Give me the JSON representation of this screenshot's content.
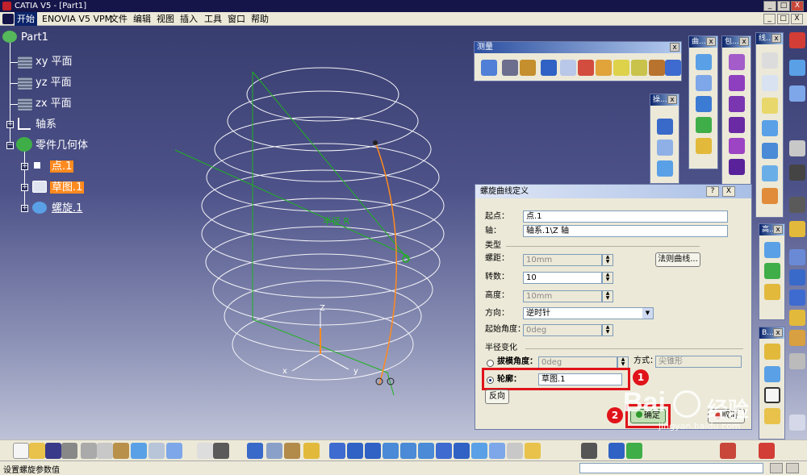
{
  "window": {
    "title": "CATIA V5 - [Part1]",
    "min": "_",
    "max": "□",
    "close": "X"
  },
  "menu": {
    "items": [
      "开始",
      "ENOVIA V5 VPM",
      "文件",
      "编辑",
      "视图",
      "插入",
      "工具",
      "窗口",
      "帮助"
    ],
    "right_buttons": [
      "_",
      "□",
      "X"
    ]
  },
  "tree": {
    "root": "Part1",
    "planes": [
      "xy 平面",
      "yz 平面",
      "zx 平面"
    ],
    "axis_system": "轴系",
    "body": "零件几何体",
    "children": [
      "点.1",
      "草图.1",
      "螺旋.1"
    ]
  },
  "toolbars": {
    "measure": "测量",
    "curves": "曲...",
    "surfaces": "包...",
    "wireframe": "线...",
    "operations": "操...",
    "advanced": "高...",
    "b": "B..."
  },
  "canvas": {
    "helix_label": "半径 R",
    "axis_z": "Z",
    "axis_x": "x",
    "axis_y": "y"
  },
  "dialog": {
    "title": "螺旋曲线定义",
    "help_btn": "?",
    "close_btn": "X",
    "start_label": "起点：",
    "start_value": "点.1",
    "axis_label": "轴：",
    "axis_value": "轴系.1\\Z 轴",
    "type_title": "类型",
    "pitch_label": "螺距：",
    "pitch_value": "10mm",
    "law_button": "法则曲线...",
    "turns_label": "转数：",
    "turns_value": "10",
    "height_label": "高度：",
    "height_value": "10mm",
    "orientation_label": "方向：",
    "orientation_value": "逆时针",
    "start_angle_label": "起始角度：",
    "start_angle_value": "0deg",
    "radius_title": "半径变化",
    "taper_label": "拔模角度：",
    "taper_value": "0deg",
    "way_label": "方式：",
    "way_value": "尖锥形",
    "profile_label": "轮廓：",
    "profile_value": "草图.1",
    "reverse_button": "反向",
    "ok_button": "确定",
    "cancel_button": "取消",
    "marker1": "1",
    "marker2": "2"
  },
  "status": {
    "text": "设置螺旋参数值"
  },
  "watermark": {
    "brand": "Bai",
    "cn": "经验",
    "url": "jingyan.baidu.com"
  },
  "colors": {
    "accent": "#ff8a1f",
    "mark": "#e0131a",
    "title": "#15154a"
  }
}
